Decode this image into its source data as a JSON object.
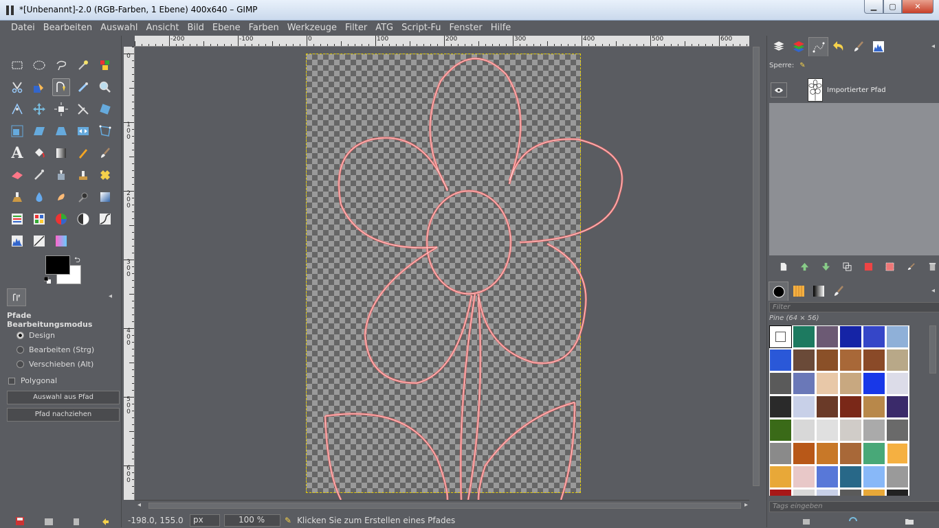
{
  "window": {
    "title": "*[Unbenannt]-2.0 (RGB-Farben, 1 Ebene) 400x640 – GIMP"
  },
  "menu": [
    "Datei",
    "Bearbeiten",
    "Auswahl",
    "Ansicht",
    "Bild",
    "Ebene",
    "Farben",
    "Werkzeuge",
    "Filter",
    "ATG",
    "Script-Fu",
    "Fenster",
    "Hilfe"
  ],
  "rulers": {
    "top": [
      "-200",
      "-100",
      "0",
      "100",
      "200",
      "300",
      "400",
      "500",
      "600"
    ],
    "left": [
      "0",
      "1\n0\n0",
      "2\n0\n0",
      "3\n0\n0",
      "4\n0\n0",
      "5\n0\n0",
      "6\n0\n0"
    ]
  },
  "tool_options": {
    "title": "Pfade",
    "subtitle": "Bearbeitungsmodus",
    "modes": [
      "Design",
      "Bearbeiten (Strg)",
      "Verschieben (Alt)"
    ],
    "selected_mode": "Design",
    "polygonal_label": "Polygonal",
    "btn_selection": "Auswahl aus Pfad",
    "btn_stroke": "Pfad nachziehen"
  },
  "status": {
    "coords": "-198.0, 155.0",
    "unit": "px",
    "zoom": "100 %",
    "message": "Klicken Sie zum Erstellen eines Pfades"
  },
  "layers": {
    "lock_label": "Sperre:",
    "layer_name": "Importierter Pfad"
  },
  "patterns": {
    "filter_placeholder": "Filter",
    "selected_name": "Pine (64 × 56)",
    "tag_placeholder": "Tags eingeben"
  },
  "colors": {
    "path": "#f06a6a",
    "selection": "#e8d000"
  }
}
